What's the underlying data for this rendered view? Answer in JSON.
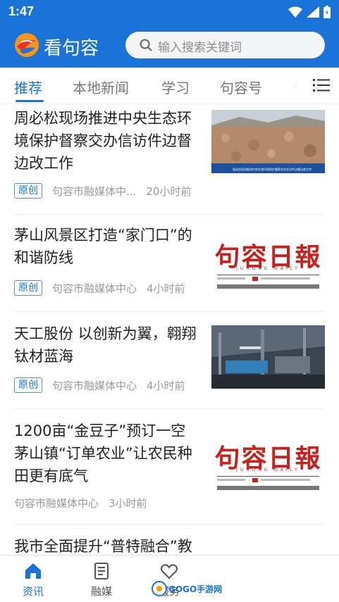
{
  "status_bar": {
    "time": "1:47"
  },
  "header": {
    "app_title": "看句容",
    "search_placeholder": "输入搜索关键词",
    "brand_color": "#1a73d6"
  },
  "tabs": [
    {
      "label": "推荐",
      "active": true
    },
    {
      "label": "本地新闻",
      "active": false
    },
    {
      "label": "学习",
      "active": false
    },
    {
      "label": "句容号",
      "active": false
    },
    {
      "label": "句",
      "active": false
    }
  ],
  "feed": [
    {
      "title": "周必松现场推进中央生态环境保护督察交办信访件边督边改工作",
      "badge": "原创",
      "source": "句容市融媒体中...",
      "time": "20小时前",
      "thumb": "landscape-photo",
      "thumb_caption": "周必松现场推进中央生态环境保护督察交办信访件边督边改工作"
    },
    {
      "title": "茅山风景区打造“家门口”的和谐防线",
      "badge": "原创",
      "source": "句容市融媒体中心",
      "time": "4小时前",
      "thumb": "newspaper",
      "paper_name": "句容日報",
      "paper_sub": "JURONG DAILY"
    },
    {
      "title": "天工股份 以创新为翼，翱翔钛材蓝海",
      "badge": "原创",
      "source": "句容市融媒体中心",
      "time": "4小时前",
      "thumb": "factory-photo"
    },
    {
      "title": "1200亩“金豆子”预订一空 茅山镇“订单农业”让农民种田更有底气",
      "badge": "",
      "source": "句容市融媒体中心",
      "time": "3小时前",
      "thumb": "newspaper",
      "paper_name": "句容日報",
      "paper_sub": "JURONG DAILY"
    },
    {
      "title": "我市全面提升“普特融合”教",
      "badge": "",
      "source": "",
      "time": "",
      "thumb": ""
    }
  ],
  "bottom_nav": [
    {
      "label": "资讯",
      "icon": "home-icon",
      "active": true
    },
    {
      "label": "融媒",
      "icon": "document-icon",
      "active": false
    },
    {
      "label": "服务",
      "icon": "heart-hands-icon",
      "active": false
    }
  ],
  "watermark": "GOGO手游网",
  "colors": {
    "accent": "#1a73d6",
    "badge_border": "#4a90d9",
    "paper_red": "#c8201c"
  }
}
